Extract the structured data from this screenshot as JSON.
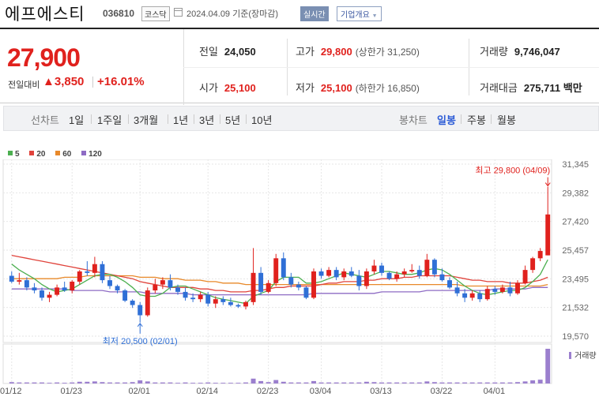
{
  "header": {
    "stock_name": "에프에스티",
    "stock_code": "036810",
    "market": "코스닥",
    "date_text": "2024.04.09  기준(장마감)",
    "realtime_label": "실시간",
    "company_label": "기업개요",
    "company_dropdown_icon": "triangle-down-icon"
  },
  "quote": {
    "price": "27,900",
    "diff_label": "전일대비",
    "diff_value": "▲3,850",
    "diff_percent": "+16.01%",
    "prev_label": "전일",
    "prev_value": "24,050",
    "high_label": "고가",
    "high_value": "29,800",
    "upper_limit": "(상한가 31,250)",
    "volume_label": "거래량",
    "volume_value": "9,746,047",
    "open_label": "시가",
    "open_value": "25,100",
    "low_label": "저가",
    "low_value": "25,100",
    "lower_limit": "(하한가 16,850)",
    "amount_label": "거래대금",
    "amount_value": "275,711 백만"
  },
  "periods": {
    "line_label": "선차트",
    "line_items": [
      "1일",
      "1주일",
      "3개월",
      "1년",
      "3년",
      "5년",
      "10년"
    ],
    "candle_label": "봉차트",
    "candle_items": [
      "일봉",
      "주봉",
      "월봉"
    ],
    "active": "일봉"
  },
  "legend": [
    {
      "label": "5",
      "color": "#4caf50"
    },
    {
      "label": "20",
      "color": "#e0433b"
    },
    {
      "label": "60",
      "color": "#e8892a"
    },
    {
      "label": "120",
      "color": "#8e6bc4"
    }
  ],
  "chart_data": {
    "type": "candlestick",
    "y_ticks": [
      "31,345",
      "29,382",
      "27,420",
      "25,457",
      "23,495",
      "21,532",
      "19,570"
    ],
    "ylim": [
      19570,
      31345
    ],
    "x_labels": [
      "01/12",
      "01/23",
      "02/01",
      "02/14",
      "02/23",
      "03/04",
      "03/13",
      "03/22",
      "04/01"
    ],
    "high_annotation": "최고 29,800 (04/09)",
    "low_annotation": "최저 20,500 (02/01)",
    "volume_label": "거래량",
    "up_color": "#e0211d",
    "down_color": "#2f6fd6",
    "candles": [
      [
        23700,
        24000,
        23200,
        23300
      ],
      [
        23300,
        23900,
        23100,
        23400
      ],
      [
        23400,
        23600,
        22700,
        22900
      ],
      [
        22900,
        23200,
        22500,
        22700
      ],
      [
        22700,
        22900,
        22000,
        22200
      ],
      [
        22200,
        22600,
        21900,
        22400
      ],
      [
        22400,
        23100,
        22300,
        22900
      ],
      [
        22900,
        23300,
        22600,
        22700
      ],
      [
        22700,
        23400,
        22500,
        23300
      ],
      [
        23300,
        24100,
        23100,
        24000
      ],
      [
        24000,
        24700,
        23700,
        23900
      ],
      [
        23900,
        25000,
        23600,
        24500
      ],
      [
        24500,
        24700,
        23200,
        23400
      ],
      [
        23400,
        23700,
        22800,
        23000
      ],
      [
        23000,
        23100,
        22500,
        22700
      ],
      [
        22700,
        22800,
        21900,
        22000
      ],
      [
        22000,
        22100,
        21500,
        21700
      ],
      [
        21700,
        21900,
        20500,
        21000
      ],
      [
        21000,
        22900,
        20900,
        22700
      ],
      [
        22700,
        23500,
        22500,
        23100
      ],
      [
        23100,
        23600,
        22800,
        23400
      ],
      [
        23400,
        23800,
        22700,
        22900
      ],
      [
        22900,
        23100,
        22400,
        22600
      ],
      [
        22600,
        22900,
        22000,
        22200
      ],
      [
        22200,
        22500,
        21900,
        22100
      ],
      [
        22100,
        22600,
        21900,
        22400
      ],
      [
        22400,
        22600,
        21600,
        21800
      ],
      [
        21800,
        22300,
        21500,
        22100
      ],
      [
        22100,
        22300,
        21700,
        21900
      ],
      [
        21900,
        22200,
        21600,
        21700
      ],
      [
        21700,
        21800,
        21500,
        21600
      ],
      [
        21600,
        22000,
        21400,
        21900
      ],
      [
        21900,
        25600,
        21700,
        23900
      ],
      [
        23900,
        24300,
        22400,
        22600
      ],
      [
        22600,
        23400,
        22500,
        23200
      ],
      [
        23200,
        25200,
        23000,
        24900
      ],
      [
        24900,
        25300,
        23400,
        23600
      ],
      [
        23600,
        23900,
        22900,
        23100
      ],
      [
        23100,
        23300,
        22700,
        22900
      ],
      [
        22900,
        23000,
        22100,
        22200
      ],
      [
        22200,
        24200,
        22100,
        24000
      ],
      [
        24000,
        24200,
        23500,
        23700
      ],
      [
        23700,
        24300,
        23600,
        24100
      ],
      [
        24100,
        24300,
        23400,
        23600
      ],
      [
        23600,
        24200,
        23400,
        24000
      ],
      [
        24000,
        24300,
        23600,
        23700
      ],
      [
        23700,
        24100,
        22700,
        23000
      ],
      [
        23000,
        24200,
        22800,
        24000
      ],
      [
        24000,
        24800,
        23800,
        24400
      ],
      [
        24400,
        24600,
        23700,
        23900
      ],
      [
        23900,
        24000,
        23400,
        23500
      ],
      [
        23500,
        24000,
        23300,
        23800
      ],
      [
        23800,
        24200,
        23600,
        24000
      ],
      [
        24000,
        24500,
        23900,
        24100
      ],
      [
        24100,
        24400,
        23500,
        23700
      ],
      [
        23700,
        25200,
        23600,
        24800
      ],
      [
        24800,
        24900,
        23600,
        23800
      ],
      [
        23800,
        24200,
        23300,
        23400
      ],
      [
        23400,
        23600,
        22800,
        22900
      ],
      [
        22900,
        23300,
        22300,
        22500
      ],
      [
        22500,
        22800,
        21900,
        22200
      ],
      [
        22200,
        22700,
        22000,
        22500
      ],
      [
        22500,
        22700,
        21900,
        22100
      ],
      [
        22100,
        23000,
        22000,
        22800
      ],
      [
        22800,
        23000,
        22400,
        22600
      ],
      [
        22600,
        23100,
        22500,
        22900
      ],
      [
        22900,
        23300,
        22300,
        22500
      ],
      [
        22500,
        23400,
        22400,
        23200
      ],
      [
        23200,
        24400,
        23100,
        24100
      ],
      [
        24100,
        25000,
        23900,
        24900
      ],
      [
        24900,
        25600,
        24700,
        25400
      ],
      [
        25100,
        29800,
        25100,
        27900
      ]
    ],
    "volumes": [
      4,
      3,
      3,
      3,
      3,
      2,
      3,
      2,
      3,
      5,
      5,
      6,
      4,
      3,
      3,
      3,
      4,
      9,
      6,
      3,
      3,
      3,
      2,
      3,
      2,
      2,
      3,
      2,
      2,
      2,
      2,
      3,
      14,
      7,
      4,
      10,
      5,
      3,
      3,
      3,
      7,
      3,
      3,
      3,
      3,
      3,
      3,
      5,
      4,
      3,
      3,
      3,
      3,
      3,
      3,
      6,
      4,
      3,
      3,
      3,
      3,
      3,
      3,
      3,
      3,
      3,
      3,
      4,
      6,
      9,
      11,
      100
    ],
    "ma5": [
      24500,
      24100,
      23800,
      23500,
      23100,
      22800,
      22600,
      22700,
      22800,
      23100,
      23400,
      23700,
      23800,
      23800,
      23600,
      23300,
      22900,
      22400,
      22300,
      22300,
      22500,
      22900,
      23000,
      23000,
      22800,
      22600,
      22400,
      22200,
      22100,
      22000,
      21900,
      21800,
      22300,
      22500,
      22700,
      23300,
      23600,
      23600,
      23600,
      23200,
      23200,
      23300,
      23500,
      23700,
      23900,
      23800,
      23700,
      23600,
      23800,
      24000,
      24000,
      23900,
      23800,
      23800,
      23900,
      24100,
      24200,
      24100,
      23800,
      23400,
      23000,
      22700,
      22500,
      22400,
      22500,
      22600,
      22700,
      22700,
      22900,
      23300,
      23800,
      24800
    ],
    "ma20": [
      25100,
      25000,
      24900,
      24800,
      24700,
      24600,
      24500,
      24400,
      24300,
      24200,
      24100,
      24000,
      23900,
      23800,
      23700,
      23600,
      23500,
      23300,
      23200,
      23100,
      23000,
      22900,
      22900,
      22900,
      22900,
      22800,
      22800,
      22700,
      22700,
      22600,
      22600,
      22600,
      22700,
      22700,
      22800,
      22900,
      22900,
      23000,
      23000,
      23000,
      23000,
      23100,
      23200,
      23200,
      23300,
      23300,
      23300,
      23400,
      23400,
      23500,
      23500,
      23500,
      23600,
      23600,
      23700,
      23700,
      23700,
      23700,
      23700,
      23600,
      23500,
      23400,
      23400,
      23300,
      23300,
      23300,
      23200,
      23200,
      23200,
      23300,
      23400,
      23600
    ],
    "ma60": [
      23500,
      23500,
      23500,
      23500,
      23500,
      23500,
      23500,
      23600,
      23600,
      23600,
      23700,
      23700,
      23700,
      23700,
      23700,
      23700,
      23700,
      23600,
      23600,
      23600,
      23500,
      23500,
      23500,
      23400,
      23400,
      23400,
      23300,
      23300,
      23200,
      23200,
      23200,
      23100,
      23100,
      23100,
      23100,
      23100,
      23100,
      23100,
      23100,
      23100,
      23100,
      23100,
      23100,
      23100,
      23100,
      23100,
      23100,
      23100,
      23100,
      23100,
      23100,
      23100,
      23100,
      23100,
      23100,
      23100,
      23100,
      23100,
      23100,
      23100,
      23000,
      23000,
      23000,
      23000,
      23000,
      23000,
      23000,
      23000,
      23000,
      23000,
      23000,
      23100
    ],
    "ma120": [
      22800,
      22800,
      22800,
      22800,
      22800,
      22800,
      22800,
      22800,
      22700,
      22700,
      22700,
      22700,
      22700,
      22600,
      22600,
      22600,
      22600,
      22600,
      22500,
      22500,
      22500,
      22500,
      22500,
      22500,
      22400,
      22400,
      22400,
      22400,
      22400,
      22400,
      22400,
      22400,
      22400,
      22400,
      22400,
      22400,
      22400,
      22400,
      22400,
      22400,
      22500,
      22500,
      22500,
      22500,
      22500,
      22500,
      22500,
      22500,
      22500,
      22600,
      22600,
      22600,
      22600,
      22600,
      22600,
      22700,
      22700,
      22700,
      22700,
      22700,
      22700,
      22700,
      22700,
      22700,
      22800,
      22800,
      22800,
      22800,
      22800,
      22900,
      22900,
      22900
    ]
  }
}
